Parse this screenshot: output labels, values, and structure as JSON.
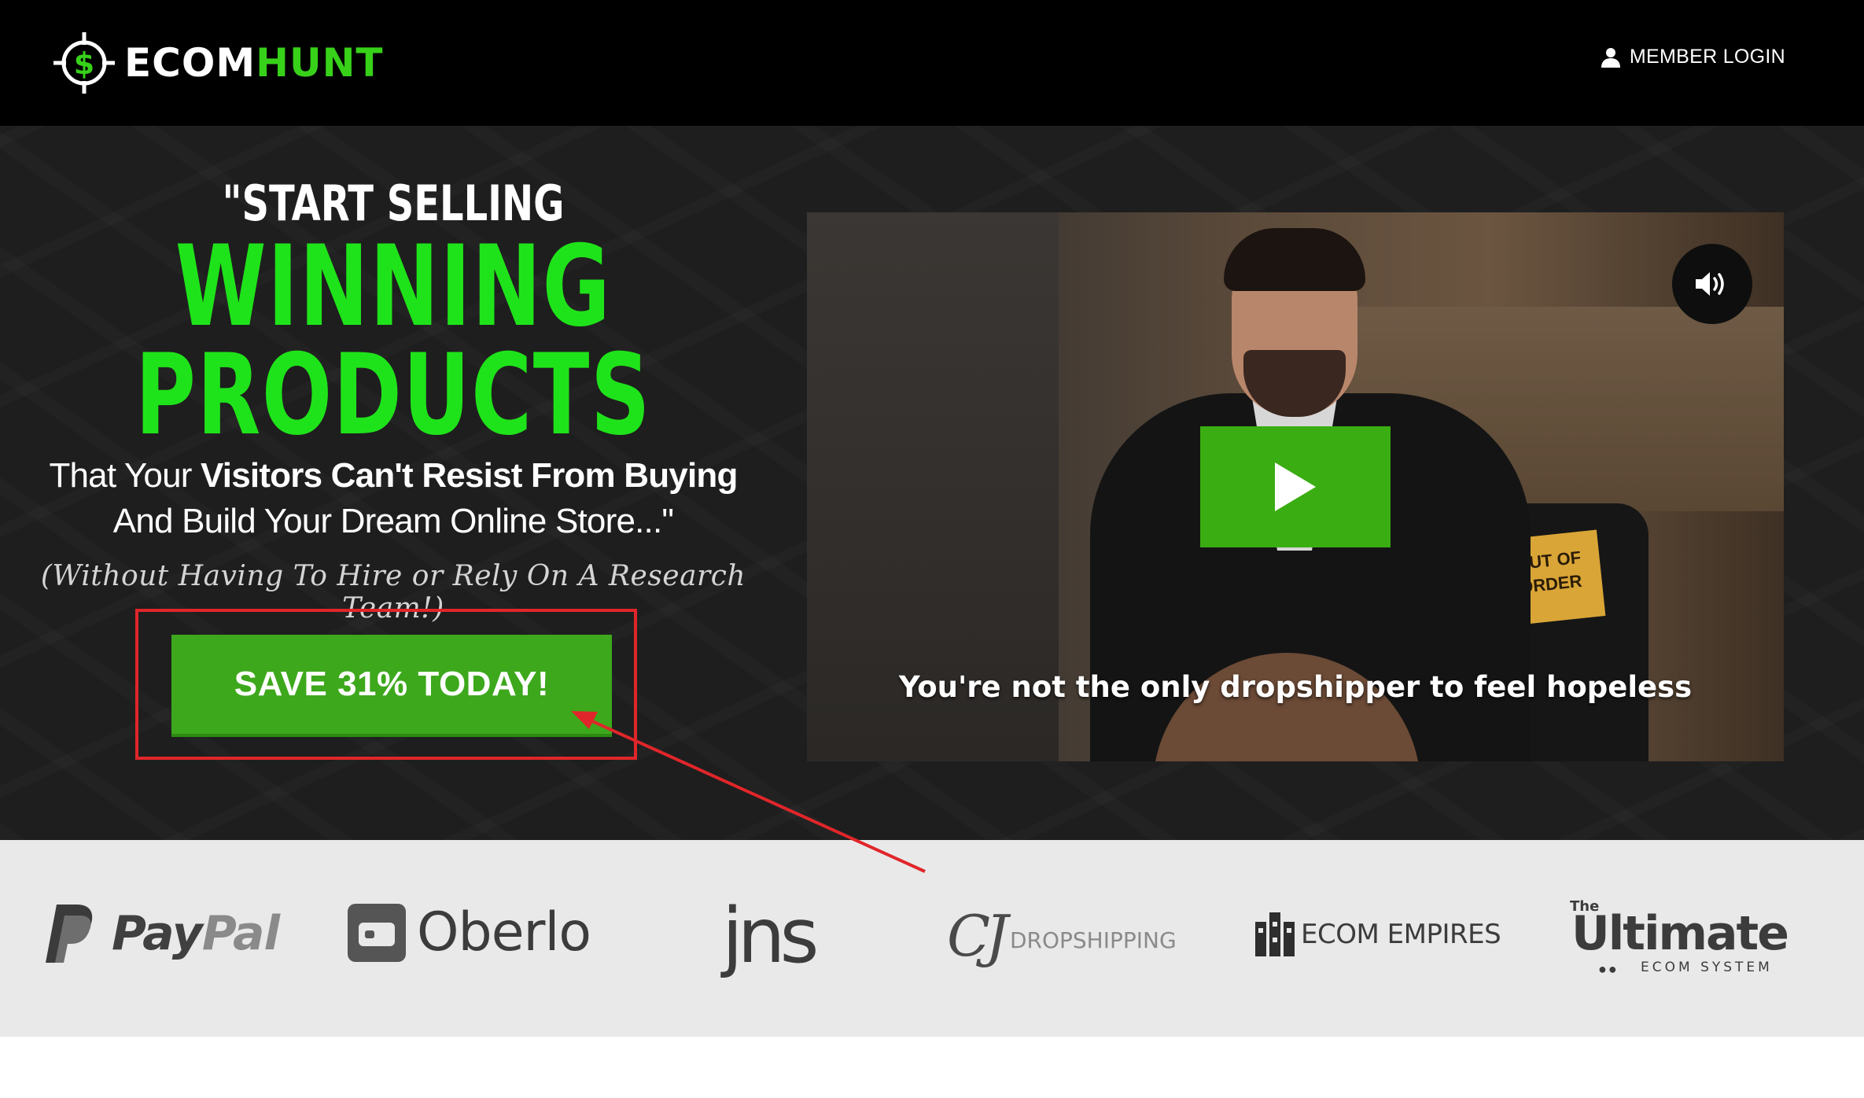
{
  "header": {
    "logo_prefix": "ECOM",
    "logo_accent": "HUNT",
    "member_login": "MEMBER LOGIN",
    "colors": {
      "background": "#000000",
      "accent": "#37d11a"
    }
  },
  "hero": {
    "line1": "\"START SELLING",
    "line2": "WINNING",
    "line3": "PRODUCTS",
    "sub_line1_plain": "That Your ",
    "sub_line1_bold": "Visitors Can't Resist From Buying",
    "sub_line2": "And Build Your Dream Online Store...\"",
    "sub_line3": "(Without Having To Hire or Rely On A Research Team!)",
    "cta_label": "SAVE 31% TODAY!",
    "colors": {
      "headline_green": "#1fe31a",
      "cta_green": "#3da81c",
      "annotation_red": "#e0262a"
    }
  },
  "video": {
    "caption": "You're not the only dropshipper to feel hopeless",
    "sign_text": "OUT OF ORDER",
    "play_icon": "play-icon",
    "sound_icon": "speaker-icon"
  },
  "partners": {
    "paypal": {
      "a": "Pay",
      "b": "Pal"
    },
    "oberlo": "Oberlo",
    "jns": "jns",
    "cj": {
      "mark": "CJ",
      "text": "DROPSHIPPING"
    },
    "ecom_empires": "ECOM EMPIRES",
    "ultimate": {
      "the": "The",
      "main": "Ultimate",
      "sub": "ECOM SYSTEM"
    }
  }
}
